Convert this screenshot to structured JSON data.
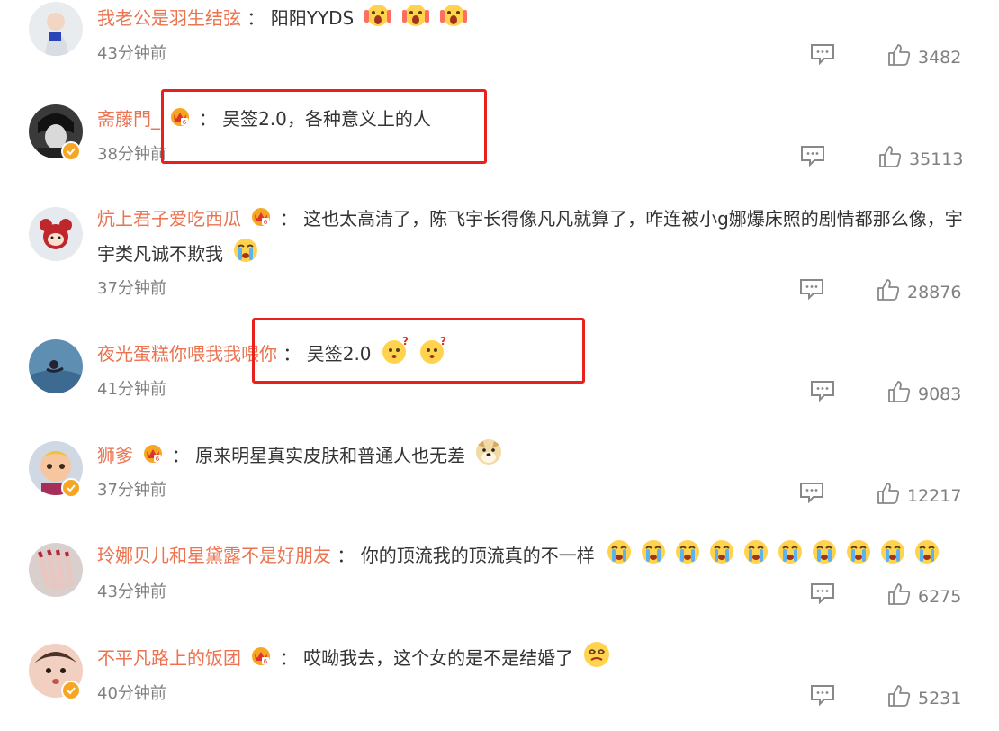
{
  "colors": {
    "username": "#eb7350",
    "text": "#333333",
    "meta": "#808080",
    "highlight": "#e8211d",
    "verified": "#f6a623"
  },
  "comments": [
    {
      "username": "我老公是羽生结弦",
      "separator": "：",
      "text": "阳阳YYDS",
      "emojis": [
        "scream-emoji",
        "scream-emoji",
        "scream-emoji"
      ],
      "time": "43分钟前",
      "likes": "3482",
      "verified": false,
      "crown": false
    },
    {
      "username": "斋藤門_",
      "separator": "：",
      "text": "吴签2.0，各种意义上的人",
      "emojis": [],
      "time": "38分钟前",
      "likes": "35113",
      "verified": true,
      "crown": true
    },
    {
      "username": "炕上君子爱吃西瓜",
      "separator": "：",
      "text": "这也太高清了，陈飞宇长得像凡凡就算了，咋连被小g娜爆床照的剧情都那么像，宇宇类凡诚不欺我",
      "emojis": [
        "cry-emoji"
      ],
      "time": "37分钟前",
      "likes": "28876",
      "verified": false,
      "crown": true
    },
    {
      "username": "夜光蛋糕你喂我我喂你",
      "separator": "：",
      "text": "吴签2.0",
      "emojis": [
        "question-face-emoji",
        "question-face-emoji"
      ],
      "time": "41分钟前",
      "likes": "9083",
      "verified": false,
      "crown": false
    },
    {
      "username": "狮爹",
      "separator": "：",
      "text": "原来明星真实皮肤和普通人也无差",
      "emojis": [
        "doge-emoji"
      ],
      "time": "37分钟前",
      "likes": "12217",
      "verified": true,
      "crown": true
    },
    {
      "username": "玲娜贝儿和星黛露不是好朋友",
      "separator": "：",
      "text": "你的顶流我的顶流真的不一样",
      "emojis": [
        "cry-emoji",
        "cry-emoji",
        "cry-emoji",
        "cry-emoji",
        "cry-emoji",
        "cry-emoji",
        "cry-emoji",
        "cry-emoji",
        "cry-emoji",
        "cry-emoji"
      ],
      "time": "43分钟前",
      "likes": "6275",
      "verified": false,
      "crown": false
    },
    {
      "username": "不平凡路上的饭团",
      "separator": "：",
      "text": "哎呦我去，这个女的是不是结婚了",
      "emojis": [
        "dizzy-face-emoji"
      ],
      "time": "40分钟前",
      "likes": "5231",
      "verified": true,
      "crown": true
    }
  ]
}
